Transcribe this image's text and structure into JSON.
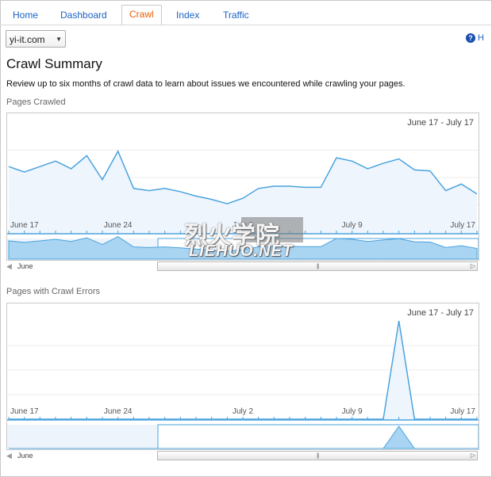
{
  "tabs": [
    {
      "label": "Home"
    },
    {
      "label": "Dashboard"
    },
    {
      "label": "Crawl",
      "active": true
    },
    {
      "label": "Index"
    },
    {
      "label": "Traffic"
    }
  ],
  "site_selector": {
    "value": "yi-it.com"
  },
  "help": {
    "label": "H",
    "icon": "help-circle-icon"
  },
  "page": {
    "title": "Crawl Summary",
    "description": "Review up to six months of crawl data to learn about issues we encountered while crawling your pages."
  },
  "colors": {
    "accent": "#e8600a",
    "link": "#1a62c4",
    "series_line": "#4aa3df",
    "series_fill": "#eef5fc",
    "overview_fill": "#a9d4f2"
  },
  "watermark": {
    "main": "烈火学院",
    "sub": "LIEHUO.NET"
  },
  "chart_data": [
    {
      "type": "line",
      "label": "Pages Crawled",
      "date_range": "June 17 - July 17",
      "x_ticks": [
        "June 17",
        "June 24",
        "July 2",
        "July 9",
        "July 17"
      ],
      "series": [
        {
          "values": [
            60,
            55,
            60,
            65,
            58,
            70,
            48,
            74,
            40,
            38,
            40,
            37,
            33,
            30,
            26,
            31,
            40,
            42,
            42,
            41,
            41,
            68,
            65,
            58,
            63,
            67,
            57,
            56,
            38,
            44,
            35
          ]
        }
      ],
      "ylim": [
        0,
        100
      ],
      "navigator": {
        "start_label": "June"
      }
    },
    {
      "type": "line",
      "label": "Pages with Crawl Errors",
      "date_range": "June 17 - July 17",
      "x_ticks": [
        "June 17",
        "June 24",
        "July 2",
        "July 9",
        "July 17"
      ],
      "series": [
        {
          "values": [
            0,
            0,
            0,
            0,
            0,
            0,
            0,
            0,
            0,
            0,
            0,
            0,
            0,
            0,
            0,
            0,
            0,
            0,
            0,
            0,
            0,
            0,
            0,
            0,
            0,
            1,
            0,
            0,
            0,
            0,
            0
          ]
        }
      ],
      "ylim": [
        0,
        1
      ],
      "navigator": {
        "start_label": "June"
      }
    }
  ]
}
